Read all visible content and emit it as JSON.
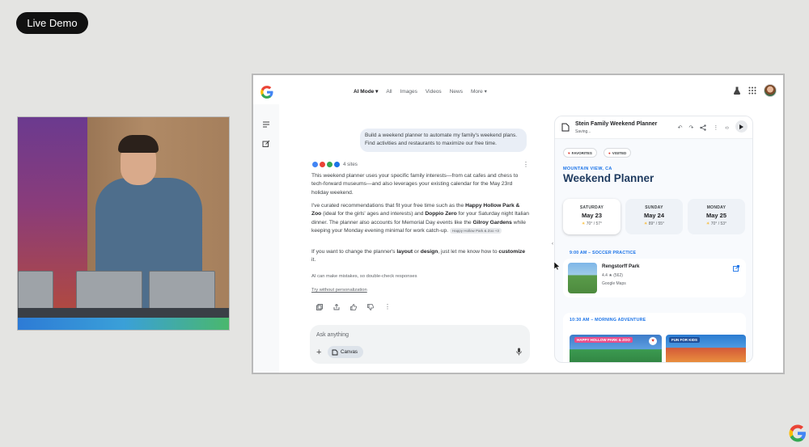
{
  "overlay": {
    "live_label": "Live Demo"
  },
  "nav": {
    "ai_mode": "AI Mode",
    "items": [
      "All",
      "Images",
      "Videos",
      "News",
      "More"
    ]
  },
  "chat": {
    "user_message": "Build a weekend planner to automate my family's weekend plans. Find activities and restaurants to maximize our free time.",
    "sources_label": "4 sites",
    "para1": "This weekend planner uses your specific family interests—from cat cafes and chess to tech-forward museums—and also leverages your existing calendar for the May 23rd holiday weekend.",
    "para2_a": "I've curated recommendations that fit your free time such as the ",
    "para2_b": "Happy Hollow Park & Zoo",
    "para2_c": " (ideal for the girls' ages and interests) and ",
    "para2_d": "Doppio Zero",
    "para2_e": " for your Saturday night Italian dinner. The planner also accounts for Memorial Day events like the ",
    "para2_f": "Gilroy Gardens",
    "para2_g": " while keeping your Monday evening minimal for work catch-up. ",
    "para2_chip": "Happy Hollow Park & Zoo +3",
    "para3_a": "If you want to change the planner's ",
    "para3_b": "layout",
    "para3_c": " or ",
    "para3_d": "design",
    "para3_e": ", just let me know how to ",
    "para3_f": "customize",
    "para3_g": " it.",
    "disclaimer": "AI can make mistakes, so double-check responses",
    "try_link": "Try without personalization",
    "ask_placeholder": "Ask anything",
    "canvas_chip": "Canvas"
  },
  "canvas": {
    "title": "Stein Family Weekend Planner",
    "status": "Saving...",
    "pill_favorites": "FAVORITES",
    "pill_visited": "VISITED",
    "location": "MOUNTAIN VIEW, CA",
    "heading": "Weekend Planner",
    "days": [
      {
        "name": "SATURDAY",
        "date": "May 23",
        "temp": "70° / 57°"
      },
      {
        "name": "SUNDAY",
        "date": "May 24",
        "temp": "89° / 55°"
      },
      {
        "name": "MONDAY",
        "date": "May 25",
        "temp": "70° / 53°"
      }
    ],
    "section1": "9:00 AM – SOCCER PRACTICE",
    "place_name": "Rengstorff Park",
    "place_rating": "4.4 ★ (562)",
    "place_source": "Google Maps",
    "section2": "10:30 AM – MORNING ADVENTURE",
    "adv1_caption": "HAPPY HOLLOW PARK & ZOO",
    "adv2_caption": "FUN FOR KIDS"
  },
  "colors": {
    "accent": "#1a73e8",
    "heading": "#1e3a5f",
    "chat_bubble": "#e9eef6"
  }
}
